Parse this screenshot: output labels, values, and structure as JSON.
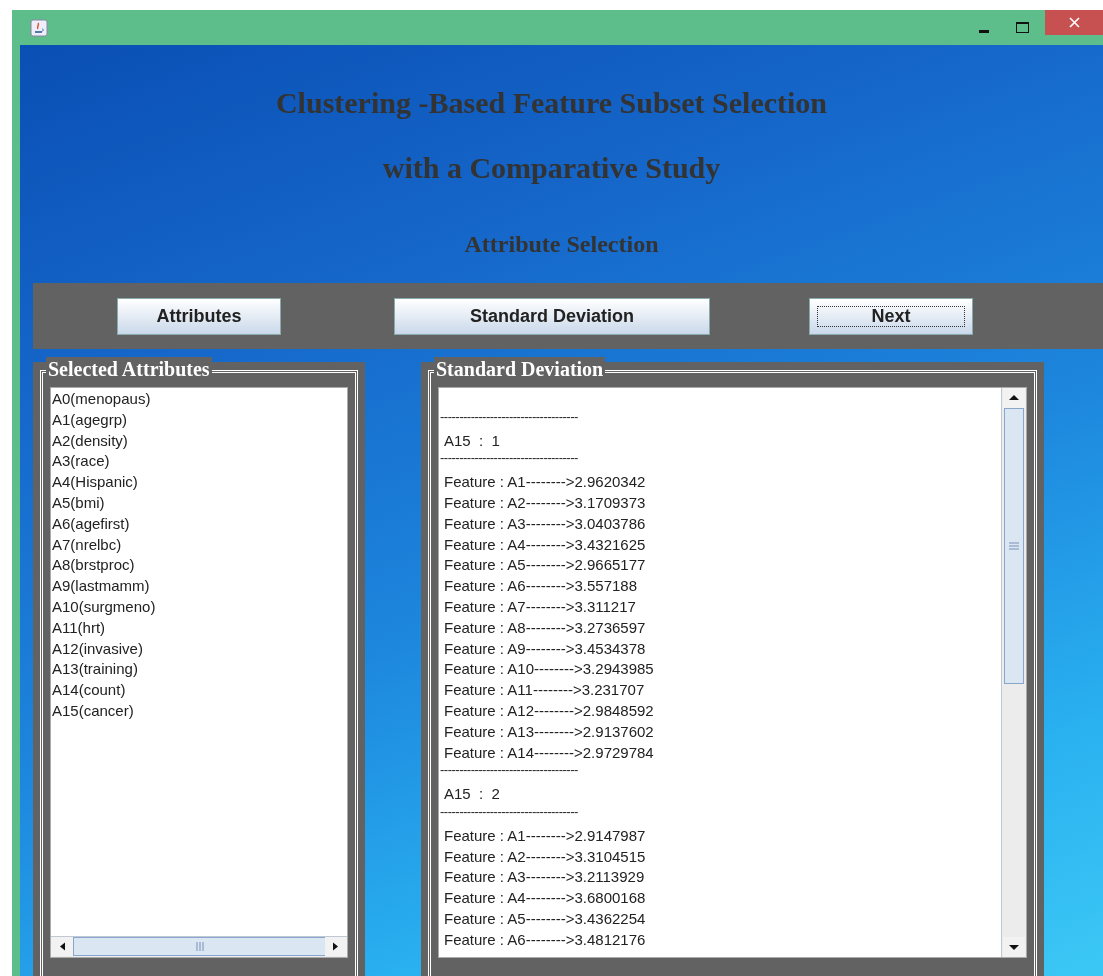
{
  "window": {
    "controls": [
      {
        "kind": "minimize"
      },
      {
        "kind": "maximize"
      },
      {
        "kind": "close"
      }
    ]
  },
  "header": {
    "title_lines": [
      "Clustering -Based Feature Subset Selection",
      "with a Comparative Study"
    ],
    "subtitle": "Attribute Selection"
  },
  "toolbar": {
    "buttons": [
      {
        "label": "Attributes",
        "focused": false
      },
      {
        "label": "Standard Deviation",
        "focused": false
      },
      {
        "label": "Next",
        "focused": true
      }
    ]
  },
  "attributes_panel": {
    "title": "Selected Attributes",
    "items": [
      "A0(menopaus)",
      "A1(agegrp)",
      "A2(density)",
      "A3(race)",
      "A4(Hispanic)",
      "A5(bmi)",
      "A6(agefirst)",
      "A7(nrelbc)",
      "A8(brstproc)",
      "A9(lastmamm)",
      "A10(surgmeno)",
      "A11(hrt)",
      "A12(invasive)",
      "A13(training)",
      "A14(count)",
      "A15(cancer)"
    ]
  },
  "deviation_panel": {
    "title": "Standard Deviation",
    "lines": [
      {
        "kind": "blank"
      },
      {
        "kind": "rule",
        "text": "------------------------------------"
      },
      {
        "kind": "class",
        "text": "A15  :  1"
      },
      {
        "kind": "rule",
        "text": "------------------------------------"
      },
      {
        "kind": "value",
        "text": "Feature : A1-------->2.9620342"
      },
      {
        "kind": "value",
        "text": "Feature : A2-------->3.1709373"
      },
      {
        "kind": "value",
        "text": "Feature : A3-------->3.0403786"
      },
      {
        "kind": "value",
        "text": "Feature : A4-------->3.4321625"
      },
      {
        "kind": "value",
        "text": "Feature : A5-------->2.9665177"
      },
      {
        "kind": "value",
        "text": "Feature : A6-------->3.557188"
      },
      {
        "kind": "value",
        "text": "Feature : A7-------->3.311217"
      },
      {
        "kind": "value",
        "text": "Feature : A8-------->3.2736597"
      },
      {
        "kind": "value",
        "text": "Feature : A9-------->3.4534378"
      },
      {
        "kind": "value",
        "text": "Feature : A10-------->3.2943985"
      },
      {
        "kind": "value",
        "text": "Feature : A11-------->3.231707"
      },
      {
        "kind": "value",
        "text": "Feature : A12-------->2.9848592"
      },
      {
        "kind": "value",
        "text": "Feature : A13-------->2.9137602"
      },
      {
        "kind": "value",
        "text": "Feature : A14-------->2.9729784"
      },
      {
        "kind": "rule",
        "text": "------------------------------------"
      },
      {
        "kind": "class",
        "text": "A15  :  2"
      },
      {
        "kind": "rule",
        "text": "------------------------------------"
      },
      {
        "kind": "value",
        "text": "Feature : A1-------->2.9147987"
      },
      {
        "kind": "value",
        "text": "Feature : A2-------->3.3104515"
      },
      {
        "kind": "value",
        "text": "Feature : A3-------->3.2113929"
      },
      {
        "kind": "value",
        "text": "Feature : A4-------->3.6800168"
      },
      {
        "kind": "value",
        "text": "Feature : A5-------->3.4362254"
      },
      {
        "kind": "value",
        "text": "Feature : A6-------->3.4812176"
      }
    ]
  }
}
